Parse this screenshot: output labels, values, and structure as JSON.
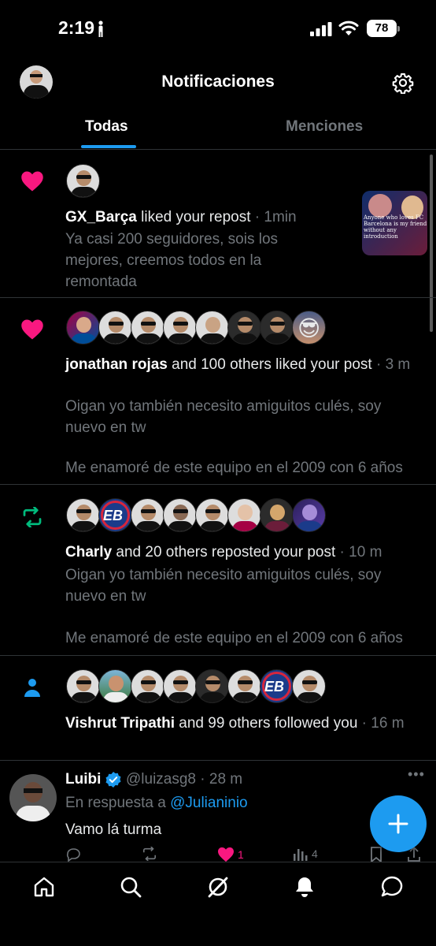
{
  "status_bar": {
    "time": "2:19",
    "battery": "78"
  },
  "header": {
    "title": "Notificaciones",
    "tabs": [
      {
        "label": "Todas",
        "active": true
      },
      {
        "label": "Menciones",
        "active": false
      }
    ]
  },
  "notifications": [
    {
      "type": "like",
      "icon": "heart-icon",
      "actor": "GX_Barça",
      "action": " liked your repost",
      "time": " · 1min",
      "text": "Ya casi 200 seguidores, sois los mejores, creemos todos en la remontada",
      "has_media": true,
      "media_text": "Anyone who loves FC Barcelona is my friend without any introduction"
    },
    {
      "type": "like",
      "icon": "heart-icon",
      "actor": "jonathan rojas",
      "action": " and 100 others liked your post",
      "time": " · 3 m",
      "text": "Oigan yo también necesito amiguitos culés, soy nuevo en tw",
      "text2": "Me enamoré de este equipo en el 2009 con 6 años"
    },
    {
      "type": "repost",
      "icon": "repost-icon",
      "actor": "Charly",
      "action": " and 20 others reposted your post",
      "time": " · 10 m",
      "text": "Oigan yo también necesito amiguitos culés, soy nuevo en tw",
      "text2": "Me enamoré de este equipo en el 2009 con 6 años"
    },
    {
      "type": "follow",
      "icon": "person-icon",
      "actor": "Vishrut Tripathi",
      "action": " and 99 others followed you",
      "time": " · 16 m"
    }
  ],
  "post": {
    "name": "Luibi",
    "handle": "@luizasg8 · 28 m",
    "reply_prefix": "En respuesta a ",
    "reply_to": "@Julianinio",
    "body": "Vamo lá turma",
    "likes": "1",
    "views": "4"
  },
  "colors": {
    "accent": "#1d9bf0",
    "like": "#f91880",
    "repost": "#00ba7c"
  }
}
